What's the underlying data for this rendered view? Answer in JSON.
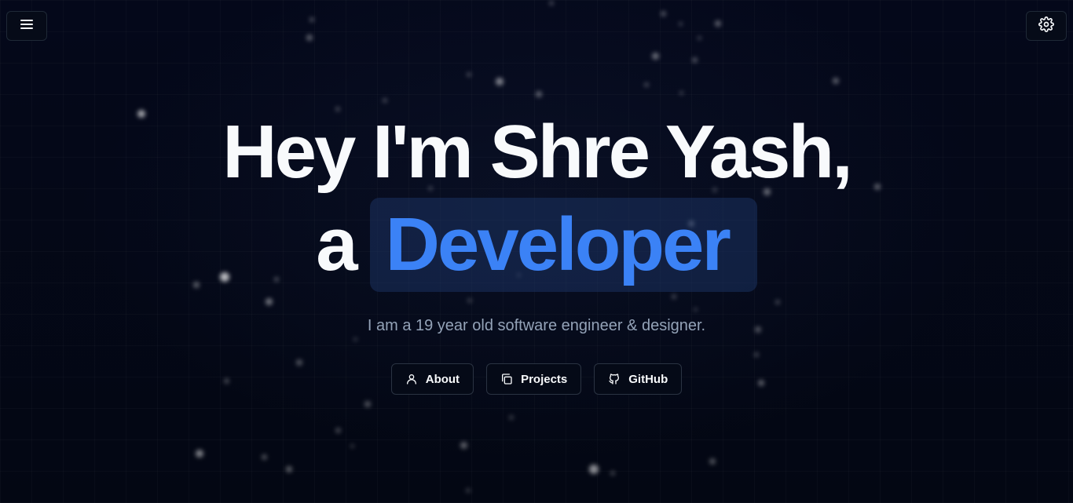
{
  "header": {
    "menu_icon": "menu-icon",
    "settings_icon": "gear-icon"
  },
  "hero": {
    "headline": "Hey I'm Shre Yash,",
    "article": "a",
    "role": "Developer",
    "subtitle": "I am a 19 year old software engineer & designer."
  },
  "actions": [
    {
      "label": "About",
      "icon": "user-icon"
    },
    {
      "label": "Projects",
      "icon": "copy-icon"
    },
    {
      "label": "GitHub",
      "icon": "github-icon"
    }
  ],
  "colors": {
    "background": "#030713",
    "accent": "#3b82f6",
    "text": "#f8fafc",
    "muted": "#94a3b8"
  }
}
